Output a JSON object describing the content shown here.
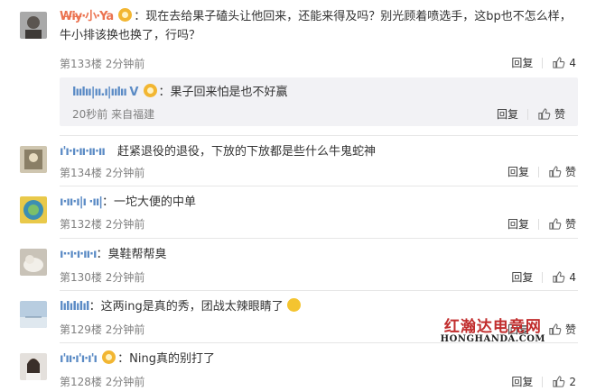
{
  "colors": {
    "username": "#eb7350",
    "meta": "#808080",
    "reply_bg": "#f2f2f5",
    "watermark": "#c12d2d"
  },
  "labels": {
    "reply": "回复",
    "like": "赞"
  },
  "comments": [
    {
      "username": "W̶iy̶·小·Ya",
      "text": "：现在去给果子磕头让他回来，还能来得及吗？别光顾着喷选手，这bp也不怎么样，牛小排该换也换了，行吗？",
      "floor": "第133楼",
      "time": "2分钟前",
      "likes": "4",
      "reply": {
        "username": "lıılıı|ıı.ı|ıılıı V",
        "text": "：果子回来怕是也不好赢",
        "time": "20秒前",
        "from": "来自福建"
      }
    },
    {
      "username": "ı'ı·ı·ıı·ıı·ıı",
      "text": "赶紧退役的退役，下放的下放都是些什么牛鬼蛇神",
      "floor": "第134楼",
      "time": "2分钟前",
      "likes": ""
    },
    {
      "username": "ı·ıı·ı|ı ·ıı|",
      "text": "：一坨大便的中单",
      "floor": "第132楼",
      "time": "2分钟前",
      "likes": ""
    },
    {
      "username": "ı··ı·ı·ıı·ı",
      "text": "：臭鞋帮帮臭",
      "floor": "第130楼",
      "time": "2分钟前",
      "likes": "4"
    },
    {
      "username": "lıIıIıIıI",
      "text": "：这两ing是真的秀，团战太辣眼睛了",
      "floor": "第129楼",
      "time": "2分钟前",
      "likes": ""
    },
    {
      "username": "ı'ıı·ı'ı·ı'ı",
      "text": "：Ning真的别打了",
      "floor": "第128楼",
      "time": "2分钟前",
      "likes": "2"
    }
  ],
  "watermark": {
    "cn": "红瀚达电竞网",
    "en": "HONGHANDA.COM"
  }
}
